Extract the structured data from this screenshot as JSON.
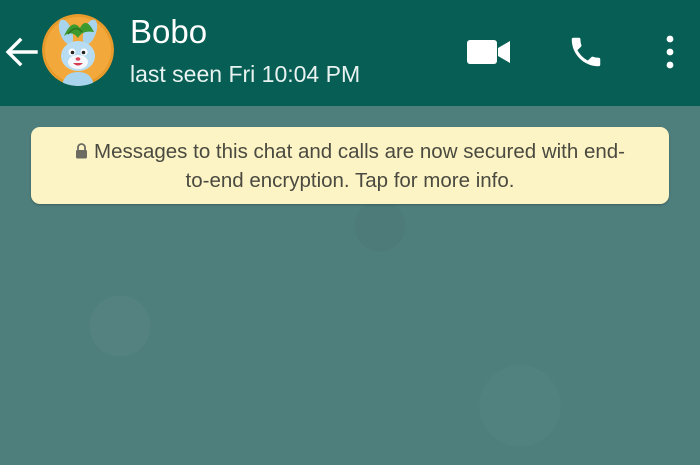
{
  "header": {
    "contact_name": "Bobo",
    "status": "last seen Fri 10:04 PM",
    "icons": {
      "back": "arrow-back-icon",
      "video": "videocam-icon",
      "call": "phone-icon",
      "menu": "more-vert-icon"
    }
  },
  "chat": {
    "notice_line1": "Messages to this chat and calls are now secured with end-",
    "notice_line2": "to-end encryption. Tap for more info."
  },
  "colors": {
    "app_bar": "#075e54",
    "chat_background": "#4f7f7d",
    "notice_background": "#fdf4c5",
    "notice_text": "#4a4a40"
  }
}
